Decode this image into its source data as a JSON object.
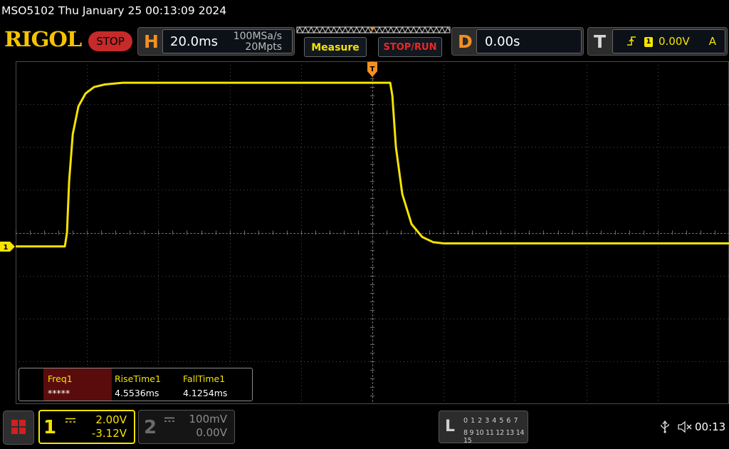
{
  "title_bar": {
    "text": "MSO5102  Thu January 25 00:13:09 2024"
  },
  "toolbar": {
    "logo": "RIGOL",
    "run_status": "STOP",
    "timebase": {
      "letter": "H",
      "scale": "20.0ms",
      "sample_rate": "100MSa/s",
      "memory_depth": "20Mpts"
    },
    "measure_label": "Measure",
    "stop_run_label": "STOP/RUN",
    "delay": {
      "letter": "D",
      "value": "0.00s"
    },
    "trigger": {
      "letter": "T",
      "source": "1",
      "level": "0.00V",
      "mode": "A"
    }
  },
  "grid": {
    "cols": 10,
    "rows": 8,
    "trigger_marker": "T",
    "ch1_marker": "1"
  },
  "measurements": [
    {
      "label": "Freq1",
      "value": "*****"
    },
    {
      "label": "RiseTime1",
      "value": "4.5536ms"
    },
    {
      "label": "FallTime1",
      "value": "4.1254ms"
    }
  ],
  "channels": [
    {
      "num": "1",
      "scale": "2.00V",
      "offset": "-3.12V",
      "active": true
    },
    {
      "num": "2",
      "scale": "100mV",
      "offset": "0.00V",
      "active": false
    }
  ],
  "logic_analyzer": {
    "letter": "L",
    "row1": "0 1 2 3  4 5 6 7",
    "row2": "8 9 10 11 12 13 14 15"
  },
  "status": {
    "clock": "00:13"
  },
  "colors": {
    "ch1": "#f5e300",
    "orange": "#f58f1f",
    "stop": "#c62a2a",
    "grid": "#4a4a4a"
  },
  "chart_data": {
    "type": "line",
    "series": [
      {
        "x_div": [
          0,
          0.69,
          0.72,
          0.75,
          0.8,
          0.88,
          0.98,
          1.1,
          1.25,
          1.5,
          2.0,
          3.0,
          4.0,
          5.0,
          5.25,
          5.28,
          5.33,
          5.42,
          5.55,
          5.7,
          5.85,
          6.0,
          6.5,
          7.5,
          10.0
        ],
        "y_div": [
          -0.32,
          -0.32,
          0.0,
          1.2,
          2.3,
          2.95,
          3.25,
          3.4,
          3.46,
          3.5,
          3.5,
          3.5,
          3.5,
          3.5,
          3.5,
          3.2,
          2.0,
          0.9,
          0.2,
          -0.1,
          -0.22,
          -0.25,
          -0.25,
          -0.25,
          -0.25
        ]
      }
    ],
    "xlim_div": [
      0,
      10
    ],
    "ylim_div": [
      -4,
      4
    ],
    "grid": true
  }
}
